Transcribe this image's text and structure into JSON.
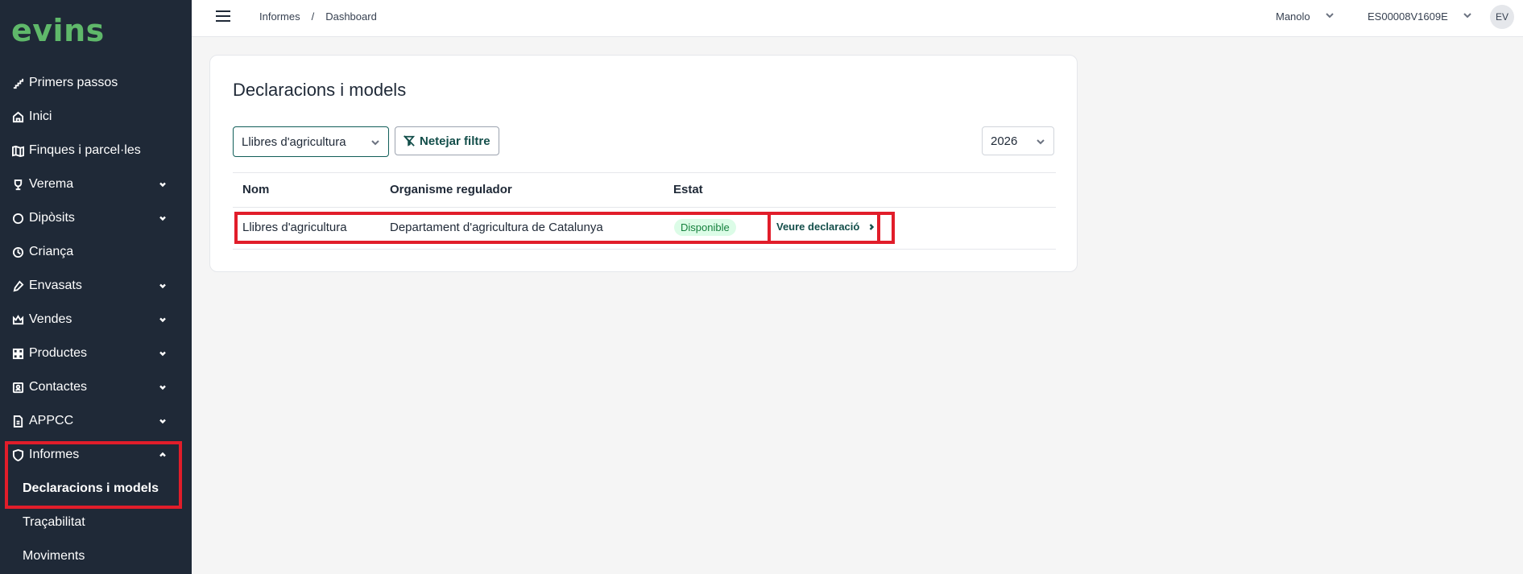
{
  "app": {
    "logo": "evins"
  },
  "sidebar": {
    "items": [
      {
        "label": "Primers passos",
        "icon": "stairs-icon",
        "has_chevron": false
      },
      {
        "label": "Inici",
        "icon": "home-icon",
        "has_chevron": false
      },
      {
        "label": "Finques i parcel·les",
        "icon": "map-icon",
        "has_chevron": false
      },
      {
        "label": "Verema",
        "icon": "trophy-icon",
        "has_chevron": true
      },
      {
        "label": "Dipòsits",
        "icon": "circle-icon",
        "has_chevron": true
      },
      {
        "label": "Criança",
        "icon": "clock-icon",
        "has_chevron": false
      },
      {
        "label": "Envasats",
        "icon": "bottle-icon",
        "has_chevron": true
      },
      {
        "label": "Vendes",
        "icon": "crown-icon",
        "has_chevron": true
      },
      {
        "label": "Productes",
        "icon": "grid-icon",
        "has_chevron": true
      },
      {
        "label": "Contactes",
        "icon": "contact-icon",
        "has_chevron": true
      },
      {
        "label": "APPCC",
        "icon": "document-icon",
        "has_chevron": true
      },
      {
        "label": "Informes",
        "icon": "shield-icon",
        "has_chevron": true,
        "expanded": true
      }
    ],
    "subitems": [
      {
        "label": "Declaracions i models",
        "active": true
      },
      {
        "label": "Traçabilitat",
        "active": false
      },
      {
        "label": "Moviments",
        "active": false
      }
    ]
  },
  "header": {
    "breadcrumb": [
      "Informes",
      "/",
      "Dashboard"
    ],
    "user": "Manolo",
    "registry": "ES00008V1609E",
    "avatar": "EV"
  },
  "main": {
    "title": "Declaracions i models",
    "filter_value": "Llibres d'agricultura",
    "clear_filter_label": "Netejar filtre",
    "year": "2026",
    "table": {
      "headers": [
        "Nom",
        "Organisme regulador",
        "Estat"
      ],
      "rows": [
        {
          "nom": "Llibres d'agricultura",
          "organisme": "Departament d'agricultura de Catalunya",
          "estat": "Disponible",
          "action": "Veure declaració"
        }
      ]
    }
  },
  "colors": {
    "sidebar_bg": "#1f2937",
    "logo": "#5fb86a",
    "accent": "#134e4a",
    "badge_bg": "#dcfce7",
    "badge_text": "#15803d",
    "highlight": "#e11d2a"
  }
}
